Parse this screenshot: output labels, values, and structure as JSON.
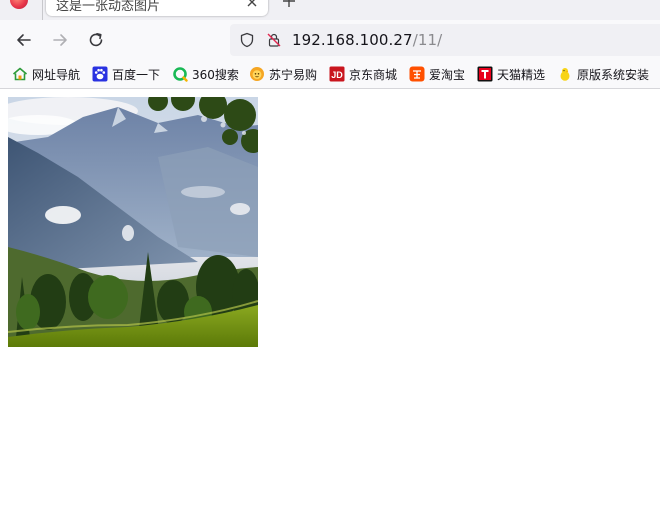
{
  "tab": {
    "title": "这是一张动态图片",
    "close_icon": "close-icon",
    "new_tab_icon": "plus-icon"
  },
  "nav": {
    "back_icon": "arrow-left-icon",
    "forward_icon": "arrow-right-icon",
    "reload_icon": "reload-icon"
  },
  "url": {
    "host": "192.168.100.27",
    "path": "/11/"
  },
  "bookmarks": [
    {
      "label": "网址导航",
      "icon": "house-icon",
      "color": "#2e9b3a"
    },
    {
      "label": "百度一下",
      "icon": "baidu-paw-icon",
      "color": "#2932e1"
    },
    {
      "label": "360搜索",
      "icon": "360-search-icon",
      "color": "#19b955"
    },
    {
      "label": "苏宁易购",
      "icon": "suning-lion-icon",
      "color": "#f5a623"
    },
    {
      "label": "京东商城",
      "icon": "jd-icon",
      "color": "#c9151e"
    },
    {
      "label": "爱淘宝",
      "icon": "taobao-icon",
      "color": "#ff5000"
    },
    {
      "label": "天猫精选",
      "icon": "tmall-icon",
      "color": "#e8001c"
    },
    {
      "label": "原版系统安装",
      "icon": "chick-icon",
      "color": "#f7d417"
    }
  ],
  "image": {
    "description_icon": "landscape-image"
  }
}
